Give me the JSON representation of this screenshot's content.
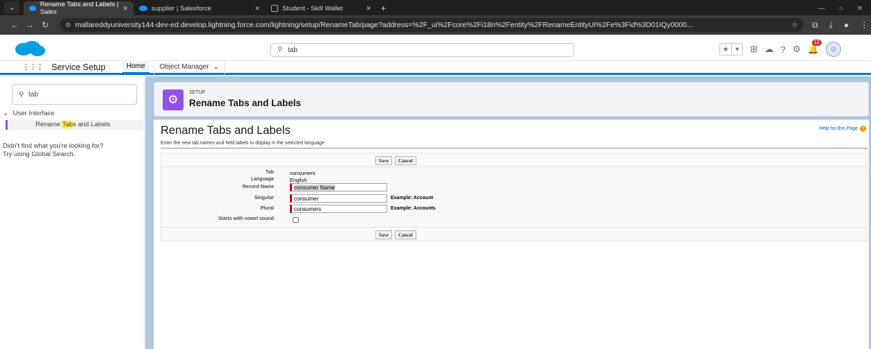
{
  "browser": {
    "tabs": [
      {
        "label": "Rename Tabs and Labels | Sales",
        "active": true
      },
      {
        "label": "supplier | Salesforce",
        "active": false
      },
      {
        "label": "Student - Skill Wallet",
        "active": false
      }
    ],
    "url": "mallareddyuniversity144-dev-ed.develop.lightning.force.com/lightning/setup/RenameTab/page?address=%2F_ui%2Fcore%2Fi18n%2Fentity%2FRenameEntityUi%2Fe%3Fid%3D01IQy0000..."
  },
  "header": {
    "search_value": "tab",
    "notification_count": "12"
  },
  "app_nav": {
    "app_name": "Service Setup",
    "home_tab": "Home",
    "object_manager_tab": "Object Manager"
  },
  "sidebar": {
    "quick_find_value": "tab",
    "section_label": "User Interface",
    "item_before": "Rename ",
    "item_highlight": "Tab",
    "item_after": "s and Labels",
    "not_found_line1": "Didn't find what you're looking for?",
    "not_found_line2": "Try using Global Search."
  },
  "page_header": {
    "eyebrow": "SETUP",
    "title": "Rename Tabs and Labels"
  },
  "content": {
    "title": "Rename Tabs and Labels",
    "help_link": "Help for this Page",
    "description": "Enter the new tab names and field labels to display in the selected language.",
    "save_label": "Save",
    "cancel_label": "Cancel"
  },
  "form": {
    "tab_label": "Tab",
    "tab_value": "consumers",
    "language_label": "Language",
    "language_value": "English",
    "record_name_label": "Record Name",
    "record_name_value": "consumer Name",
    "singular_label": "Singular",
    "singular_value": "consumer",
    "singular_example": "Example: Account",
    "plural_label": "Plural",
    "plural_value": "consumers",
    "plural_example": "Example: Accounts",
    "vowel_label": "Starts with vowel sound"
  },
  "colors": {
    "brand_blue": "#0176d3",
    "setup_purple": "#9050e9",
    "required_red": "#cc0000"
  }
}
